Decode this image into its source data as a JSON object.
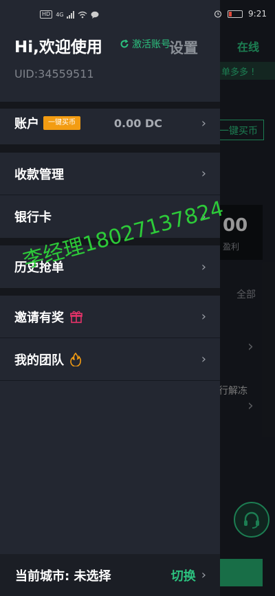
{
  "status_bar": {
    "network": "4G",
    "time": "9:21"
  },
  "background_page": {
    "online_label": "在线",
    "stripe_text": "单多多 !",
    "buy_button": "一键买币",
    "number_text": "00",
    "number_label": "盈利",
    "filter_all": "全部",
    "unfreeze_text": "行解冻"
  },
  "drawer": {
    "greeting": "Hi,欢迎使用",
    "activate_label": "激活账号",
    "settings_label": "设置",
    "uid": "UID:34559511",
    "account": {
      "label": "账户",
      "badge": "一键买币",
      "balance": "0.00 DC"
    },
    "menu": [
      {
        "label": "收款管理"
      },
      {
        "label": "银行卡"
      },
      {
        "label": "历史抢单"
      },
      {
        "label": "邀请有奖"
      },
      {
        "label": "我的团队"
      }
    ],
    "footer": {
      "city_label": "当前城市: 未选择",
      "switch_label": "切换"
    }
  },
  "watermark": "李经理18027137824",
  "colors": {
    "accent": "#2cc27f",
    "badge": "#f39c12",
    "gift": "#e8336a",
    "fire": "#f39c12",
    "watermark": "#2ed93a"
  }
}
